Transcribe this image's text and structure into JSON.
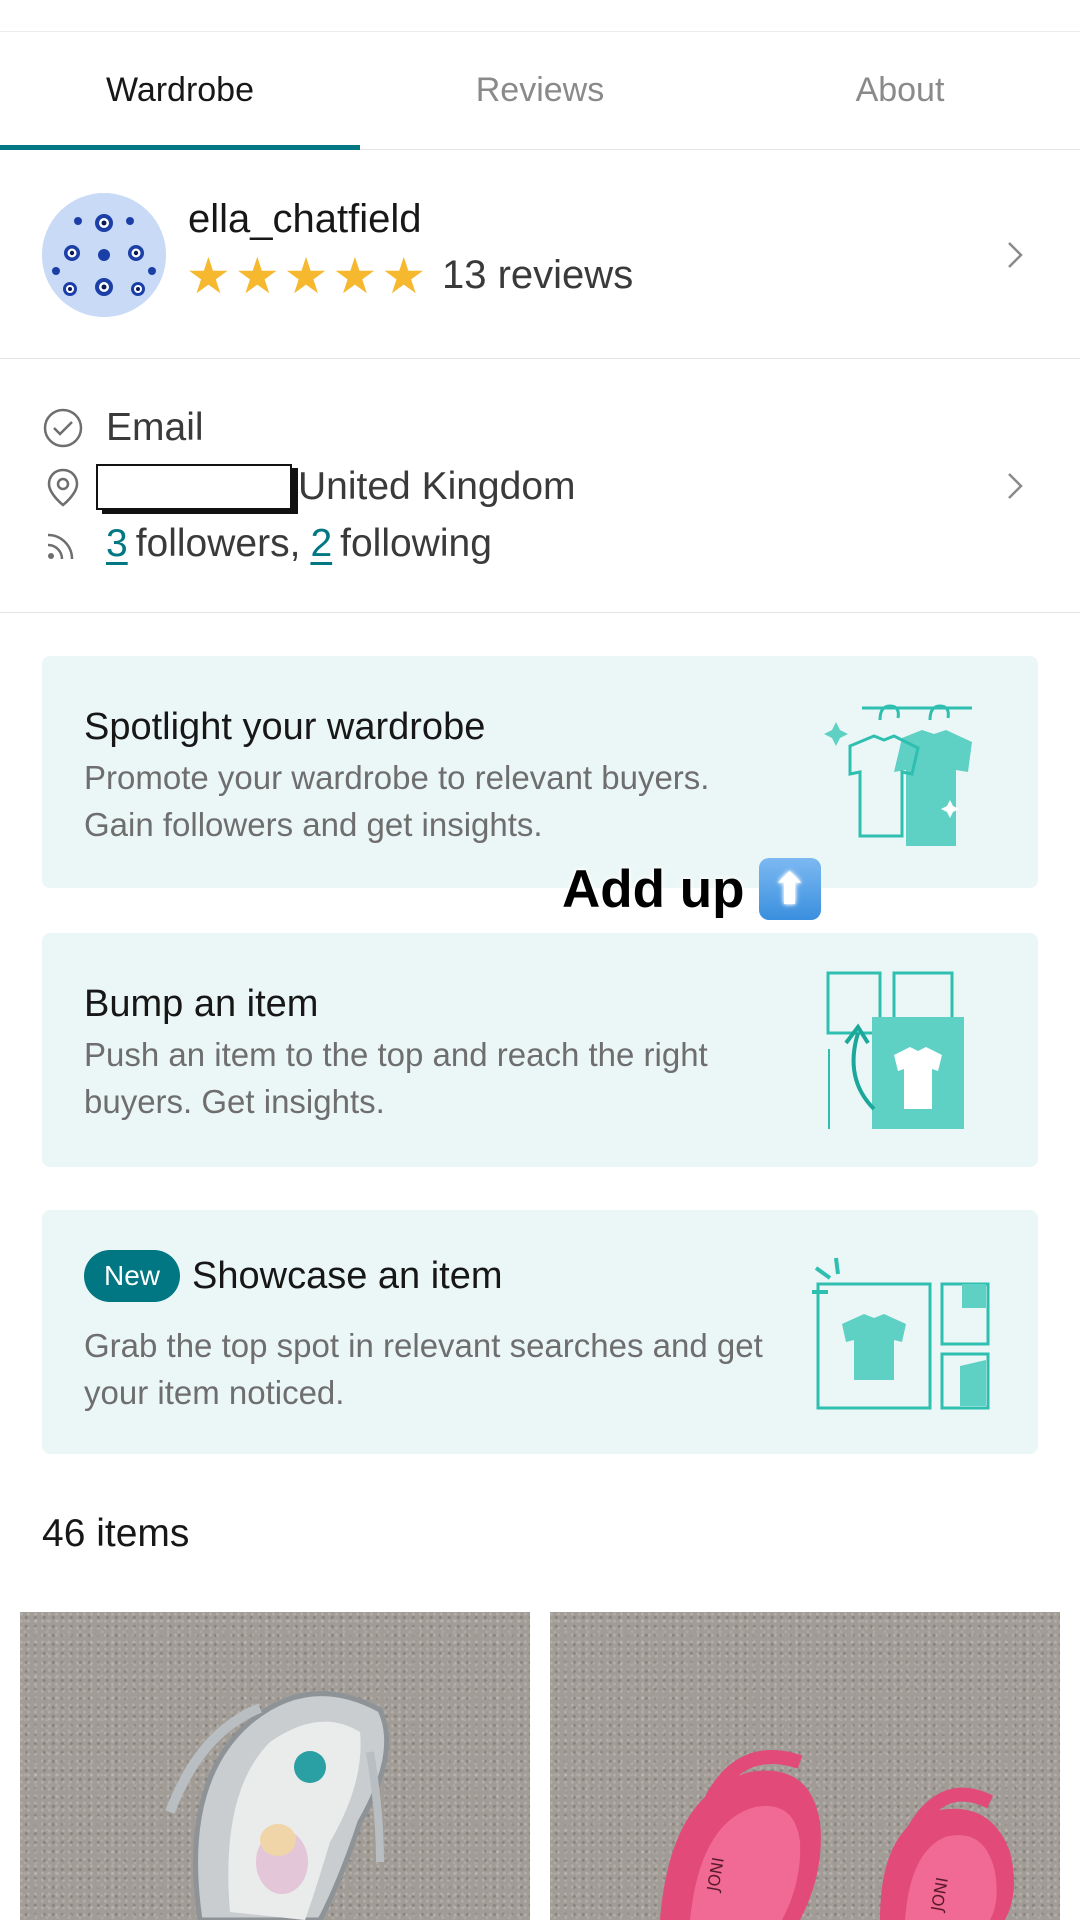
{
  "tabs": [
    {
      "label": "Wardrobe",
      "active": true
    },
    {
      "label": "Reviews",
      "active": false
    },
    {
      "label": "About",
      "active": false
    }
  ],
  "profile": {
    "username": "ella_chatfield",
    "rating": 5,
    "reviews_label": "13 reviews"
  },
  "info": {
    "verified": "Email",
    "location": "United Kingdom",
    "followers_count": "3",
    "followers_label": "followers,",
    "following_count": "2",
    "following_label": "following"
  },
  "promos": [
    {
      "title": "Spotlight your wardrobe",
      "description": "Promote your wardrobe to relevant buyers. Gain followers and get insights."
    },
    {
      "title": "Bump an item",
      "description": "Push an item to the top and reach the right buyers. Get insights."
    },
    {
      "badge": "New",
      "title": "Showcase an item",
      "description": "Grab the top spot in relevant searches and get your item noticed."
    }
  ],
  "overlay": {
    "text": "Add up",
    "emoji": "⬆"
  },
  "items_count": "46 items",
  "colors": {
    "accent": "#007782",
    "card_bg": "#ebf7f6",
    "illustration": "#5fd0c4",
    "star": "#f5b82e"
  }
}
